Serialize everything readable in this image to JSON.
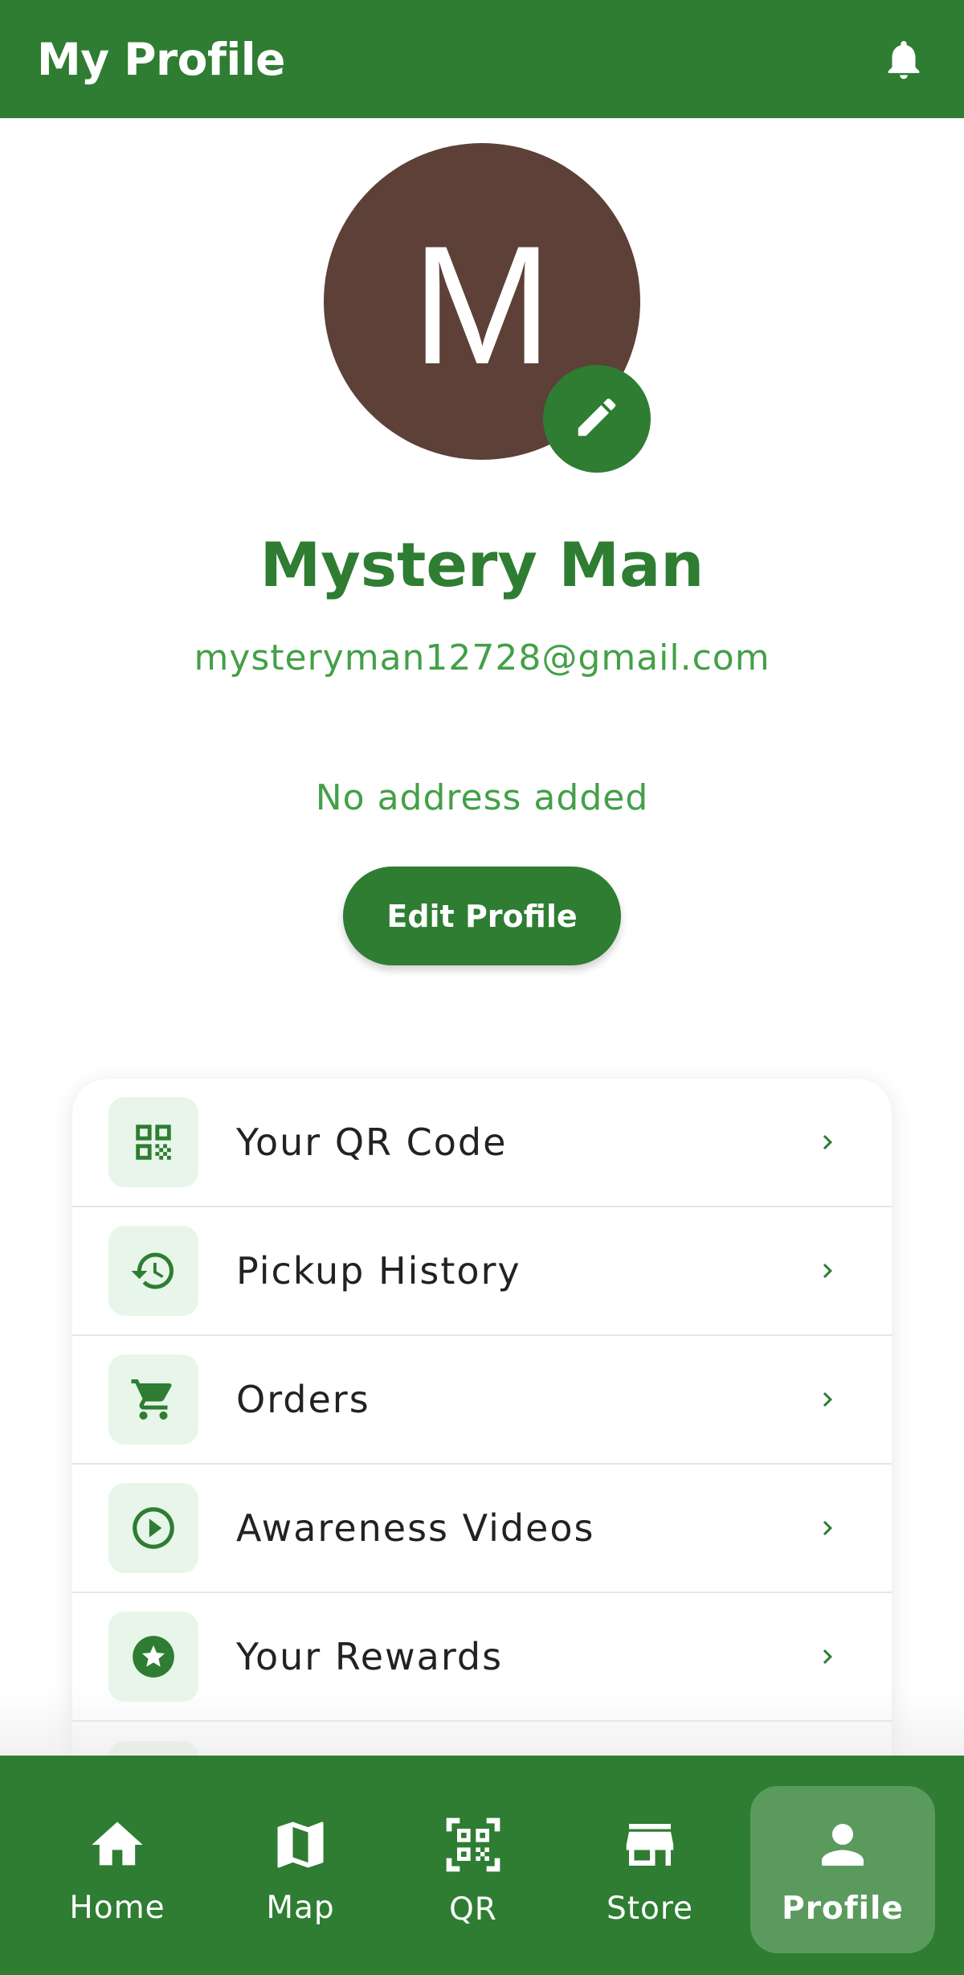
{
  "header": {
    "title": "My Profile",
    "bell_icon": "notifications-bell-icon"
  },
  "profile": {
    "avatar_letter": "M",
    "avatar_color": "#5d4037",
    "edit_icon": "pencil-icon",
    "name": "Mystery Man",
    "email": "mysteryman12728@gmail.com",
    "address": "No address added",
    "edit_button_label": "Edit Profile"
  },
  "menu": {
    "items": [
      {
        "label": "Your QR Code",
        "icon": "qr-code-icon"
      },
      {
        "label": "Pickup History",
        "icon": "history-icon"
      },
      {
        "label": "Orders",
        "icon": "cart-icon"
      },
      {
        "label": "Awareness Videos",
        "icon": "play-circle-icon"
      },
      {
        "label": "Your Rewards",
        "icon": "star-badge-icon"
      }
    ]
  },
  "bottom_nav": {
    "items": [
      {
        "label": "Home",
        "icon": "home-icon",
        "active": false
      },
      {
        "label": "Map",
        "icon": "map-icon",
        "active": false
      },
      {
        "label": "QR",
        "icon": "qr-scan-icon",
        "active": false
      },
      {
        "label": "Store",
        "icon": "store-icon",
        "active": false
      },
      {
        "label": "Profile",
        "icon": "person-icon",
        "active": true
      }
    ]
  },
  "colors": {
    "primary": "#2e7d32",
    "accent_text": "#43a047",
    "icon_bg": "#e8f5e9",
    "active_tab_bg": "#5a9b5d"
  }
}
